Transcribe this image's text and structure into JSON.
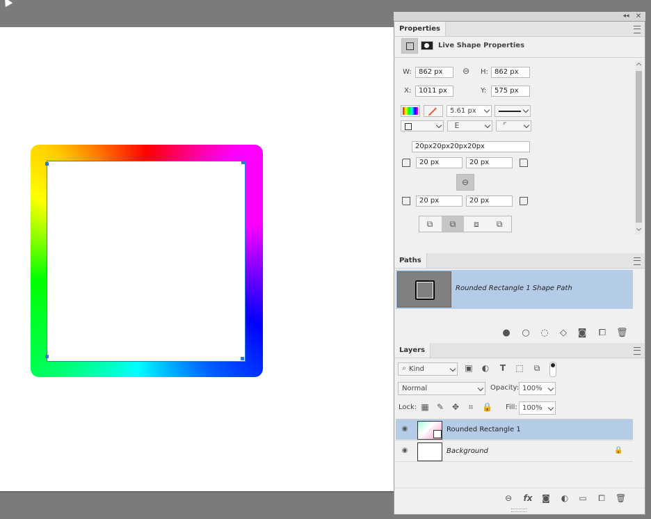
{
  "properties": {
    "tab": "Properties",
    "title": "Live Shape Properties",
    "w_label": "W:",
    "w_value": "862 px",
    "h_label": "H:",
    "h_value": "862 px",
    "x_label": "X:",
    "x_value": "1011 px",
    "y_label": "Y:",
    "y_value": "575 px",
    "stroke_width": "5.61 px",
    "corner_radii": "20px20px20px20px",
    "corner_tl": "20 px",
    "corner_tr": "20 px",
    "corner_bl": "20 px",
    "corner_br": "20 px"
  },
  "paths": {
    "tab": "Paths",
    "item": "Rounded Rectangle 1 Shape Path"
  },
  "layers": {
    "tab": "Layers",
    "filter": "Kind",
    "blend_mode": "Normal",
    "opacity_label": "Opacity:",
    "opacity_value": "100%",
    "lock_label": "Lock:",
    "fill_label": "Fill:",
    "fill_value": "100%",
    "items": [
      {
        "name": "Rounded Rectangle 1"
      },
      {
        "name": "Background"
      }
    ]
  },
  "colors": {
    "canvas_bg": "#ffffff",
    "workspace": "#7b7b7b",
    "selection": "#b5cce8",
    "handle": "#2b7bd6"
  }
}
